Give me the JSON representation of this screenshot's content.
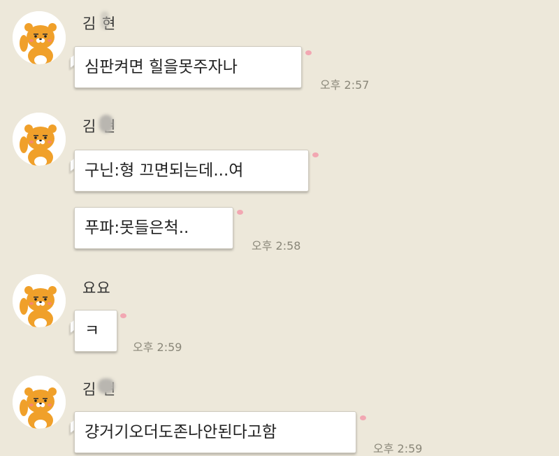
{
  "messages": [
    {
      "sender": "김   현",
      "bubbles": [
        "심판켜면 힐을못주자나"
      ],
      "time": "오후 2:57"
    },
    {
      "sender": "김   현",
      "bubbles": [
        "구닌:형 끄면되는데...여",
        "푸파:못들은척.."
      ],
      "time": "오후 2:58"
    },
    {
      "sender": "요요",
      "bubbles": [
        "ㅋ"
      ],
      "time": "오후 2:59"
    },
    {
      "sender": "김   현",
      "bubbles": [
        "걍거기오더도존나안된다고함"
      ],
      "time": "오후 2:59"
    }
  ],
  "colors": {
    "background": "#ede8da",
    "bubble": "#ffffff",
    "bubble_dot": "#f2a7b2",
    "avatar_fill": "#f0a02a"
  },
  "icons": {
    "avatar": "ryan-lion-avatar-icon"
  }
}
